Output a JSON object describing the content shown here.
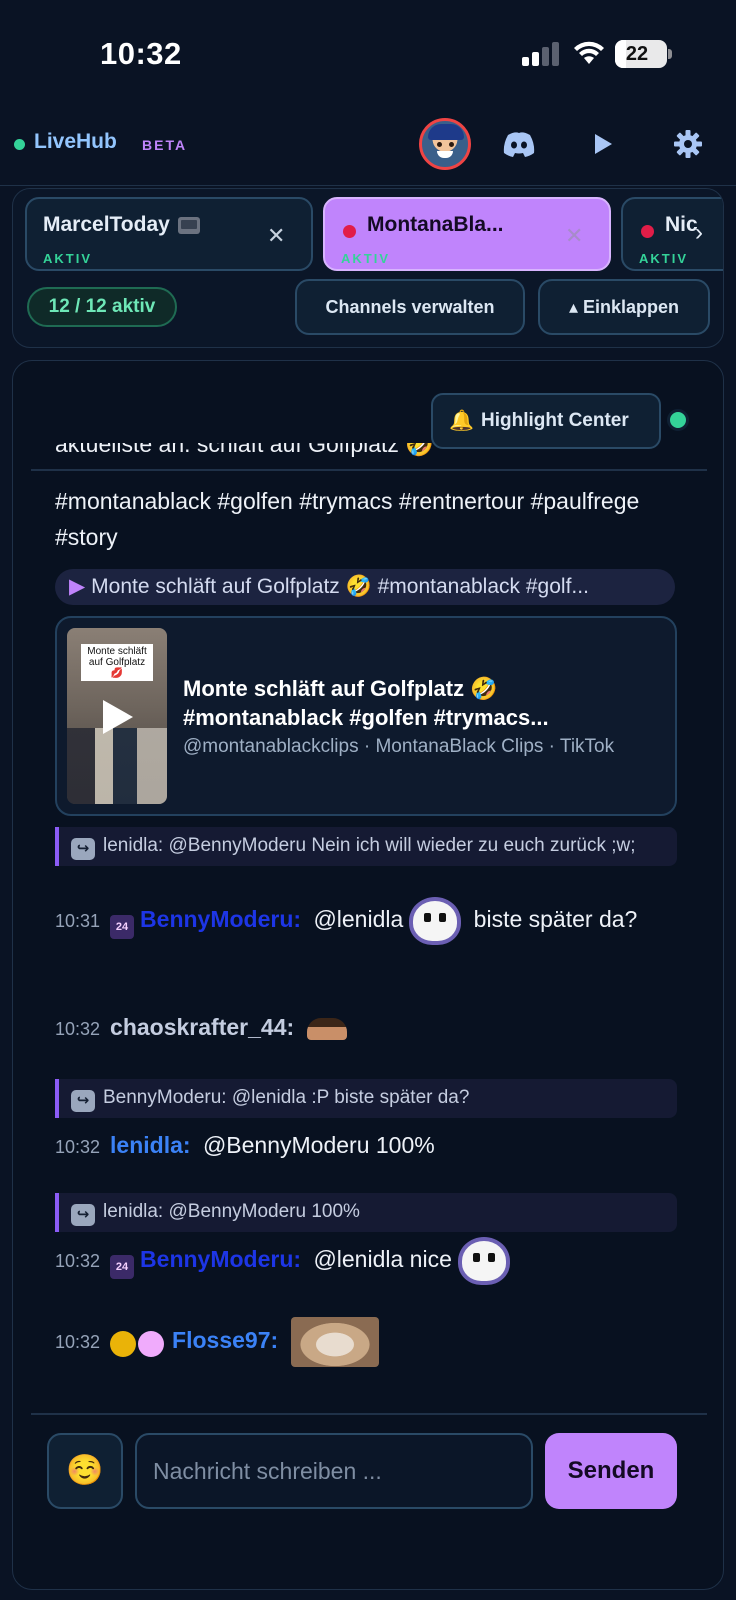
{
  "status_bar": {
    "time": "10:32",
    "battery": "22",
    "battery_level": 0.22
  },
  "header": {
    "brand": "LiveHub",
    "beta": "BETA"
  },
  "channels": {
    "tabs": [
      {
        "name": "MarcelToday",
        "status": "AKTIV",
        "active": false
      },
      {
        "name": "MontanaBla...",
        "status": "AKTIV",
        "active": true
      },
      {
        "name": "Nic",
        "status": "AKTIV",
        "active": false
      }
    ],
    "count": "12 / 12 aktiv",
    "manage_label": "Channels verwalten",
    "collapse_label": "▴ Einklappen"
  },
  "chat": {
    "highlight_label": "Highlight Center",
    "cut_line": "aktuellste   an.    schläft auf Golfplatz 🤣",
    "message_text": "#montanablack #golfen #trymacs #rentnertour #paulfrege #story",
    "link_pill": "Monte schläft auf Golfplatz 🤣 #montanablack #golf...",
    "preview": {
      "caption": "Monte schläft auf Golfplatz 💋",
      "title": "Monte schläft auf Golfplatz 🤣 #montanablack #golfen #trymacs...",
      "meta": "@montanablackclips · MontanaBlack Clips · TikTok"
    },
    "messages": [
      {
        "reply": "lenidla: @BennyModeru Nein ich will wieder zu euch zurück ;w;",
        "time": "10:31",
        "badge": "24",
        "user": "BennyModeru:",
        "text_a": "@lenidla",
        "text_b": "biste später da?"
      },
      {
        "time": "10:32",
        "user": "chaoskrafter_44:"
      },
      {
        "reply": "BennyModeru: @lenidla :P biste später da?",
        "time": "10:32",
        "user": "lenidla:",
        "text_a": "@BennyModeru 100%"
      },
      {
        "reply": "lenidla: @BennyModeru 100%",
        "time": "10:32",
        "badge": "24",
        "user": "BennyModeru:",
        "text_a": "@lenidla nice"
      },
      {
        "time": "10:32",
        "user": "Flosse97:"
      }
    ]
  },
  "composer": {
    "placeholder": "Nachricht schreiben ...",
    "send_label": "Senden",
    "emoji": "☺️"
  }
}
